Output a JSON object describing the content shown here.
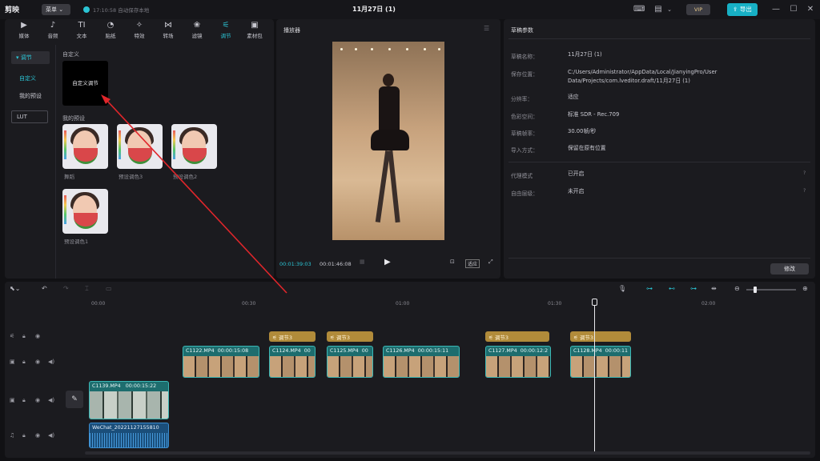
{
  "app": {
    "logo": "剪映",
    "menu_label": "菜单",
    "autosave": "17:10:58 自动保存本地",
    "title": "11月27日 (1)",
    "vip_label": "VIP",
    "export_label": "导出"
  },
  "tools": [
    {
      "label": "媒体",
      "icon": "media-icon"
    },
    {
      "label": "音频",
      "icon": "audio-icon"
    },
    {
      "label": "文本",
      "icon": "text-icon"
    },
    {
      "label": "贴纸",
      "icon": "sticker-icon"
    },
    {
      "label": "特效",
      "icon": "effects-icon"
    },
    {
      "label": "转场",
      "icon": "transition-icon"
    },
    {
      "label": "滤镜",
      "icon": "filter-icon"
    },
    {
      "label": "调节",
      "icon": "adjust-icon",
      "active": true
    },
    {
      "label": "素材包",
      "icon": "package-icon"
    }
  ],
  "adjust_sidebar": {
    "section": "调节",
    "items": [
      "自定义",
      "我的预设"
    ],
    "lut": "LUT"
  },
  "adjust_content": {
    "custom_heading": "自定义",
    "custom_card": "自定义调节",
    "presets_heading": "我的预设",
    "presets": [
      "舞蹈",
      "预设调色3",
      "预设调色2",
      "预设调色1"
    ]
  },
  "player": {
    "title": "播放器",
    "current_time": "00:01:39:03",
    "total_time": "00:01:46:08",
    "ratio_label": "适应"
  },
  "draft": {
    "title": "草稿参数",
    "fields": [
      {
        "label": "草稿名称：",
        "value": "11月27日 (1)"
      },
      {
        "label": "保存位置：",
        "value": "C:/Users/Administrator/AppData/Local/JianyingPro/User Data/Projects/com.lveditor.draft/11月27日 (1)"
      },
      {
        "label": "分辨率：",
        "value": "适应"
      },
      {
        "label": "色彩空间：",
        "value": "标准 SDR - Rec.709"
      },
      {
        "label": "草稿帧率：",
        "value": "30.00帧/秒"
      },
      {
        "label": "导入方式：",
        "value": "保留在原有位置"
      }
    ],
    "extra": [
      {
        "label": "代理模式",
        "value": "已开启"
      },
      {
        "label": "自由层级：",
        "value": "未开启"
      }
    ],
    "modify_label": "修改"
  },
  "timeline": {
    "ruler": [
      "00:00",
      "00:30",
      "01:00",
      "01:30",
      "02:00"
    ],
    "adjust_clips": [
      "调节3",
      "调节3",
      "调节3",
      "调节3"
    ],
    "video_clips": [
      {
        "name": "C1122.MP4",
        "duration": "00:00:15:08"
      },
      {
        "name": "C1124.MP4",
        "duration": "00"
      },
      {
        "name": "C1125.MP4",
        "duration": "00"
      },
      {
        "name": "C1126.MP4",
        "duration": "00:00:15:11"
      },
      {
        "name": "C1127.MP4",
        "duration": "00:00:12:2"
      },
      {
        "name": "C1128.MP4",
        "duration": "00:00:11"
      }
    ],
    "main_clip": {
      "name": "C1139.MP4",
      "duration": "00:00:15:22"
    },
    "audio_clip": {
      "name": "WeChat_20221127155810"
    }
  },
  "colors": {
    "accent": "#2bc4d4",
    "adjust_clip": "#b18b3a",
    "video_clip": "#1d6d6e",
    "audio_clip": "#1a4e7a",
    "annotation_arrow": "#e0262b"
  }
}
